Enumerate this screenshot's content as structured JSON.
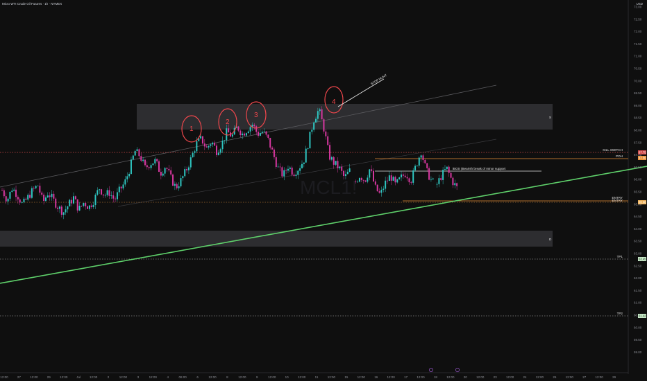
{
  "header": {
    "title": "Micro WTI Crude Oil Futures · 1h · NYMEX",
    "currency": "USD"
  },
  "watermark": "MCL1!",
  "colors": {
    "background": "#0f0f0f",
    "bull": "#2ec5c0",
    "bear": "#d6379f",
    "zone": "#2c2c2e",
    "support": "#5fd16b",
    "orange": "#e8913a",
    "red": "#d24a4a",
    "circle": "#f0474c"
  },
  "price_axis": {
    "labels": [
      "73.00",
      "72.50",
      "72.00",
      "71.50",
      "71.00",
      "70.50",
      "70.00",
      "69.50",
      "69.00",
      "68.50",
      "68.00",
      "67.50",
      "67.00",
      "66.50",
      "66.00",
      "65.50",
      "65.00",
      "64.50",
      "64.00",
      "63.50",
      "63.00",
      "62.50",
      "62.00",
      "61.50",
      "61.00",
      "60.50",
      "60.00",
      "59.50",
      "59.00"
    ]
  },
  "time_axis": {
    "labels": [
      "12:00",
      "27",
      "12:00",
      "29",
      "12:00",
      "Jul",
      "12:00",
      "2",
      "12:00",
      "3",
      "12:00",
      "4",
      "06:00",
      "6",
      "12:00",
      "8",
      "12:00",
      "9",
      "12:00",
      "10",
      "12:00",
      "11",
      "12:00",
      "15",
      "12:00",
      "16",
      "12:00",
      "17",
      "12:00",
      "18",
      "12:00",
      "20",
      "12:00",
      "23",
      "12:00",
      "24",
      "12:00",
      "26",
      "12:00",
      "27",
      "12:00",
      "29"
    ]
  },
  "chart_data": {
    "type": "candlestick",
    "symbol": "MCL1!",
    "interval": "1h",
    "y_range": [
      58.8,
      73.4
    ],
    "close_series": [
      65.9,
      65.5,
      66.0,
      65.7,
      65.3,
      65.6,
      65.9,
      66.1,
      65.4,
      65.8,
      65.5,
      65.2,
      65.0,
      65.3,
      65.6,
      65.1,
      65.4,
      65.2,
      65.5,
      66.0,
      65.7,
      65.8,
      65.5,
      65.9,
      66.2,
      66.8,
      67.5,
      67.3,
      66.8,
      67.0,
      67.1,
      66.6,
      66.9,
      66.4,
      66.0,
      66.3,
      66.7,
      67.2,
      67.8,
      68.0,
      67.6,
      67.9,
      67.5,
      67.8,
      68.3,
      68.1,
      68.5,
      68.2,
      68.4,
      68.6,
      68.2,
      68.3,
      68.0,
      67.4,
      66.8,
      66.5,
      66.9,
      66.6,
      66.8,
      67.1,
      67.9,
      68.8,
      69.2,
      68.4,
      67.3,
      67.0,
      66.8,
      66.4,
      66.7,
      66.2,
      66.5,
      66.3,
      66.8,
      66.0,
      65.7,
      66.2,
      66.5,
      66.1,
      66.4,
      66.6,
      66.3,
      66.9,
      67.5,
      66.7,
      66.3,
      66.1,
      66.5,
      66.8,
      66.3,
      66.0
    ],
    "hlines": [
      {
        "label": "KILL SWITCH",
        "price": 67.8,
        "style": "dotted-red",
        "tag": "67.75"
      },
      {
        "label": "POH",
        "price": 67.45,
        "style": "solid-orange",
        "tag": "67.50"
      },
      {
        "label": "iBOS (Bearish break of minor support",
        "price": 66.95,
        "style": "solid-white"
      },
      {
        "label": "ENTRY",
        "price": 65.88,
        "style": "dotted-orange",
        "tag": "65.88"
      },
      {
        "label": "TP1",
        "price": 63.45,
        "style": "dotted-white",
        "tag": "63.45"
      },
      {
        "label": "TP2",
        "price": 61.42,
        "style": "dotted-white",
        "tag": "61.42"
      }
    ],
    "zones": [
      {
        "label": "S",
        "top": 69.15,
        "bottom": 68.22
      },
      {
        "label": "D",
        "top": 64.55,
        "bottom": 63.95
      }
    ],
    "trendlines": [
      {
        "name": "support",
        "from": [
          0,
          62.5
        ],
        "to": [
          932,
          67.25
        ],
        "color": "green"
      },
      {
        "name": "channel-top",
        "from": [
          0,
          67.3
        ],
        "to": [
          715,
          70.7
        ],
        "color": "gray"
      },
      {
        "name": "channel-mid",
        "from": [
          170,
          65.0
        ],
        "to": [
          715,
          68.4
        ],
        "color": "gray"
      }
    ],
    "numbered_tops": [
      {
        "label": "1",
        "price": 68.4
      },
      {
        "label": "2",
        "price": 68.7
      },
      {
        "label": "3",
        "price": 68.85
      },
      {
        "label": "4",
        "price": 69.6
      }
    ],
    "annotations": [
      {
        "label": "STOP HUNT"
      }
    ]
  },
  "annotations": {
    "kill": "KILL SWITCH",
    "poh": "POH",
    "ibos": "iBOS (Bearish break of minor support",
    "entry_a": "ENTRY",
    "entry_b": "ENTRY",
    "tp1": "TP1",
    "tp2": "TP2",
    "stop_hunt": "STOP HUNT",
    "zone_s": "S",
    "zone_d": "D",
    "n1": "1",
    "n2": "2",
    "n3": "3",
    "n4": "4",
    "price_tags": {
      "kill": "67.75",
      "poh": "67.50",
      "entry": "65.88",
      "tp1": "63.45",
      "tp2": "61.42"
    }
  }
}
